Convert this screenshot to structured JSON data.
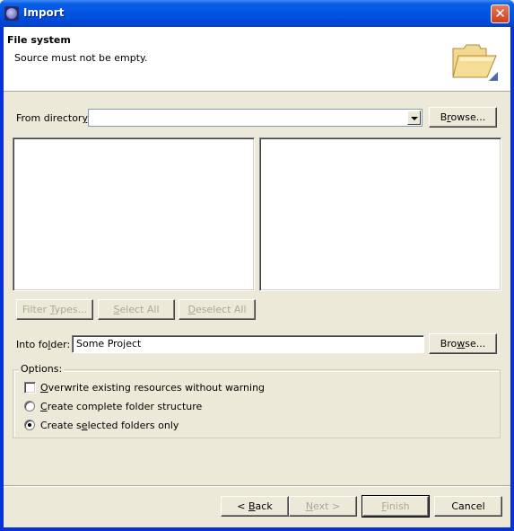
{
  "window": {
    "title": "Import",
    "app_icon": "eclipse-icon",
    "close_icon": "close-icon"
  },
  "banner": {
    "title": "File system",
    "message": "Source must not be empty.",
    "icon": "open-folder-icon"
  },
  "from_directory": {
    "label": "From directory:",
    "value": "",
    "browse_label": "Browse..."
  },
  "lists": {
    "folders": [],
    "files": []
  },
  "selection_buttons": {
    "filter_types": "Filter Types...",
    "select_all": "Select All",
    "deselect_all": "Deselect All"
  },
  "into_folder": {
    "label": "Into folder:",
    "value": "Some Project",
    "browse_label": "Browse..."
  },
  "options": {
    "legend": "Options:",
    "overwrite": {
      "label": "Overwrite existing resources without warning",
      "checked": false
    },
    "complete_structure": {
      "label": "Create complete folder structure",
      "selected": false
    },
    "selected_only": {
      "label": "Create selected folders only",
      "selected": true
    }
  },
  "footer": {
    "back": "< Back",
    "next": "Next >",
    "finish": "Finish",
    "cancel": "Cancel"
  }
}
